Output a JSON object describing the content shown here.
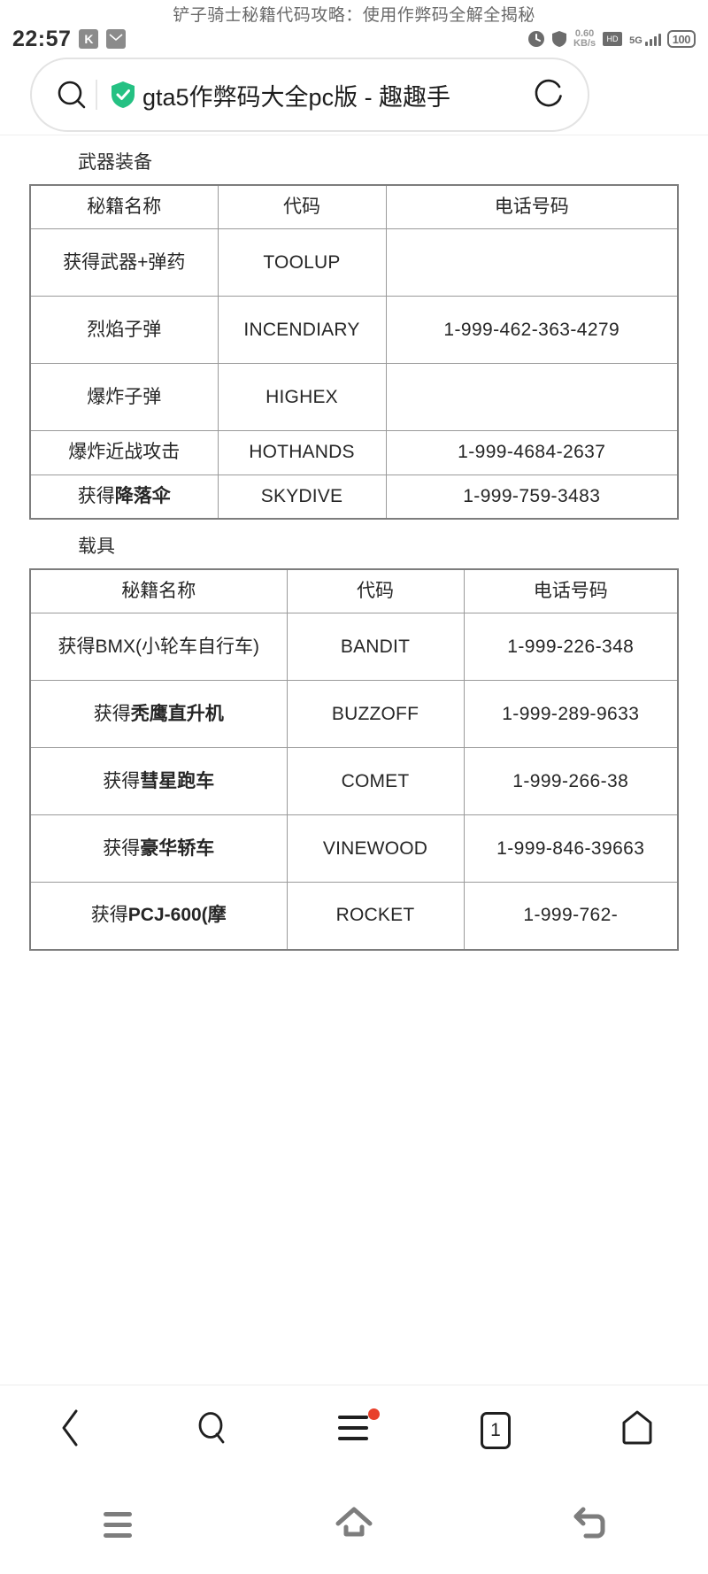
{
  "page": {
    "overlay_title": "铲子骑士秘籍代码攻略：使用作弊码全解全揭秘"
  },
  "statusbar": {
    "time": "22:57",
    "badge_k": "K",
    "badge_mail": "M",
    "net_rate": "0.60",
    "net_unit": "KB/s",
    "network_type": "5G",
    "battery": "100"
  },
  "urlbar": {
    "search_icon": "search-icon",
    "shield_icon": "shield-check-icon",
    "title": "gta5作弊码大全pc版 - 趣趣手",
    "reload_icon": "reload-icon"
  },
  "sections": [
    {
      "heading": "武器装备",
      "columns": [
        "秘籍名称",
        "代码",
        "电话号码"
      ],
      "rows": [
        {
          "name": "获得武器+弹药",
          "name_bold": "",
          "code": "TOOLUP",
          "phone": ""
        },
        {
          "name": "烈焰子弹",
          "name_bold": "",
          "code": "INCENDIARY",
          "phone": "1-999-462-363-4279"
        },
        {
          "name": "爆炸子弹",
          "name_bold": "",
          "code": "HIGHEX",
          "phone": ""
        },
        {
          "name": "爆炸近战攻击",
          "name_bold": "",
          "code": "HOTHANDS",
          "phone": "1-999-4684-2637"
        },
        {
          "name": "获得",
          "name_bold": "降落伞",
          "code": "SKYDIVE",
          "phone": "1-999-759-3483"
        }
      ]
    },
    {
      "heading": "载具",
      "columns": [
        "秘籍名称",
        "代码",
        "电话号码"
      ],
      "rows": [
        {
          "name": "获得BMX(小轮车自行车)",
          "name_bold": "",
          "code": "BANDIT",
          "phone": "1-999-226-348"
        },
        {
          "name": "获得",
          "name_bold": "秃鹰直升机",
          "code": "BUZZOFF",
          "phone": "1-999-289-9633"
        },
        {
          "name": "获得",
          "name_bold": "彗星跑车",
          "code": "COMET",
          "phone": "1-999-266-38"
        },
        {
          "name": "获得",
          "name_bold": "豪华轿车",
          "code": "VINEWOOD",
          "phone": "1-999-846-39663"
        },
        {
          "name": "获得",
          "name_bold": "PCJ-600(摩",
          "code": "ROCKET",
          "phone": "1-999-762-"
        }
      ]
    }
  ],
  "browser_nav": {
    "items": [
      {
        "icon": "back-chevron-icon",
        "label": ""
      },
      {
        "icon": "search-icon",
        "label": ""
      },
      {
        "icon": "menu-hamburger-icon",
        "label": "",
        "badge": true
      },
      {
        "icon": "tab-count-icon",
        "label": "1"
      },
      {
        "icon": "home-icon",
        "label": ""
      }
    ]
  },
  "system_nav": {
    "items": [
      {
        "icon": "recents-icon"
      },
      {
        "icon": "home-icon"
      },
      {
        "icon": "back-icon"
      }
    ]
  },
  "colors": {
    "shield_green": "#25c183",
    "badge_red": "#e8402a",
    "table_border": "#9a9a9a",
    "text": "#262626"
  }
}
